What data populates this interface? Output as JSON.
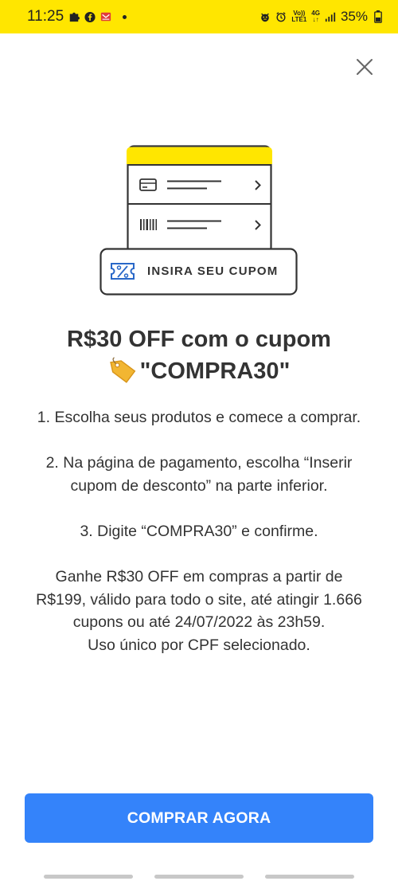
{
  "status_bar": {
    "time": "11:25",
    "battery": "35%",
    "volte_top": "Vo))",
    "volte_bottom": "LTE1",
    "network": "4G"
  },
  "illustration": {
    "coupon_label": "INSIRA SEU CUPOM",
    "accent_color": "#ffe600"
  },
  "promo": {
    "title_line1": "R$30 OFF com o cupom",
    "title_line2": "\"COMPRA30\"",
    "steps": [
      "1. Escolha seus produtos e comece a comprar.",
      "2. Na página de pagamento, escolha “Inserir cupom de desconto” na parte inferior.",
      "3. Digite “COMPRA30” e confirme.",
      "Ganhe R$30 OFF em compras a partir de R$199, válido para todo o site, até atingir 1.666 cupons ou até 24/07/2022 às 23h59.",
      "Uso único por CPF selecionado."
    ]
  },
  "cta": {
    "label": "COMPRAR AGORA",
    "color": "#3483fa"
  },
  "icons": {
    "close": "close-icon",
    "tag": "price-tag-icon",
    "card": "credit-card-icon",
    "barcode": "barcode-icon",
    "coupon": "coupon-percent-icon"
  }
}
